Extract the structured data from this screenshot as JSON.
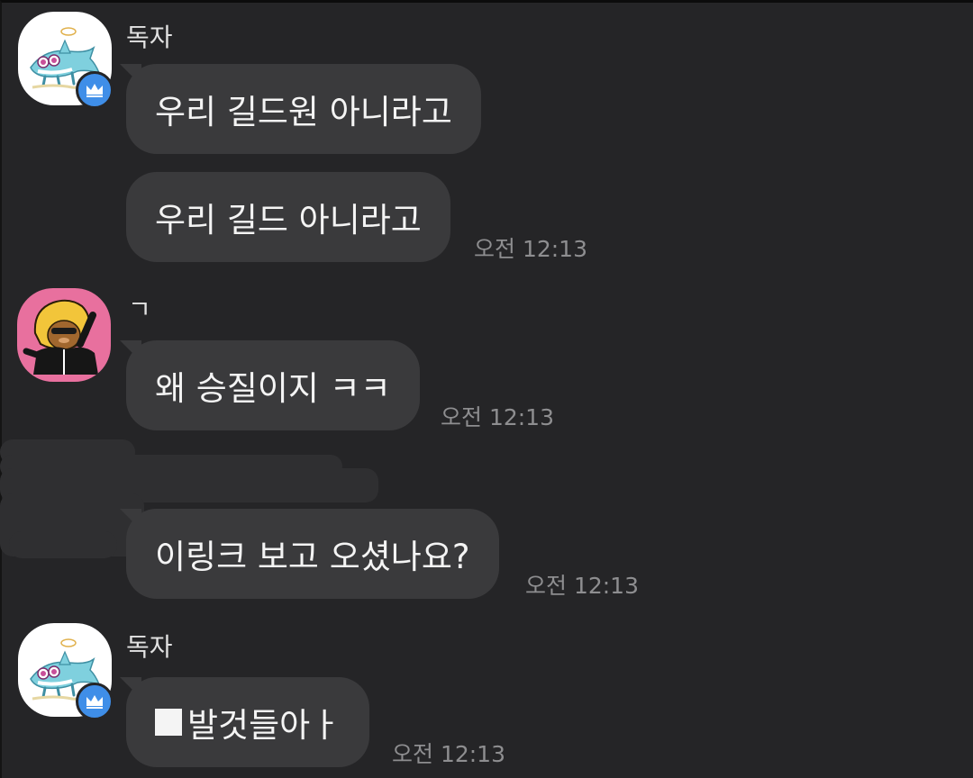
{
  "messages": [
    {
      "sender": "독자",
      "bubbles": [
        "우리 길드원 아니라고",
        "우리 길드 아니라고"
      ],
      "time": "오전 12:13"
    },
    {
      "sender": "ㄱ",
      "bubbles": [
        "왜 승질이지 ㅋㅋ"
      ],
      "time": "오전 12:13"
    },
    {
      "sender": "",
      "bubbles": [
        "이링크 보고 오셨나요?"
      ],
      "time": "오전 12:13"
    },
    {
      "sender": "독자",
      "bubbles": [
        "발것들아ㅏ"
      ],
      "time": "오전 12:13"
    }
  ],
  "icons": {
    "crown_badge": "crown-icon",
    "avatar_1": "shark-character-avatar",
    "avatar_2": "lion-character-avatar",
    "message_prefix": "black-square"
  },
  "colors": {
    "background": "#252527",
    "bubble": "#3a3a3c",
    "badge": "#3f8ee8",
    "time_text": "#8e8e90"
  }
}
